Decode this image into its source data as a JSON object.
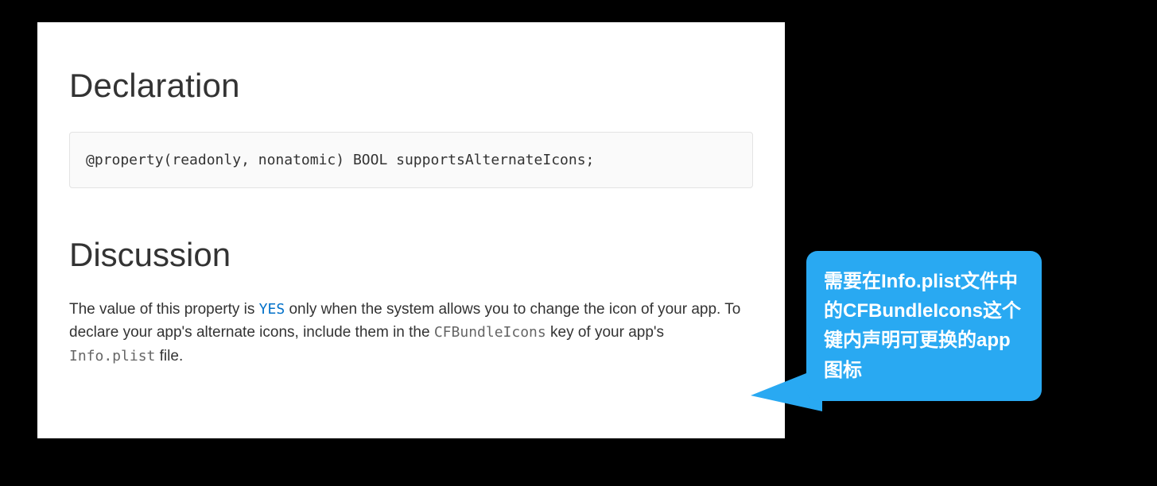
{
  "doc": {
    "declaration": {
      "heading": "Declaration",
      "code": "@property(readonly, nonatomic) BOOL supportsAlternateIcons;"
    },
    "discussion": {
      "heading": "Discussion",
      "pre": "The value of this property is ",
      "yes": "YES",
      "mid1": " only when the system allows you to change the icon of your app. To declare your app's alternate icons, include them in the ",
      "code1": "CFBundleIcons",
      "mid2": " key of your app's ",
      "code2": "Info.plist",
      "end": " file."
    }
  },
  "callout": {
    "text": "需要在Info.plist文件中的CFBundleIcons这个键内声明可更换的app图标"
  },
  "colors": {
    "callout_bg": "#29a9f2",
    "link_blue": "#0070c9"
  }
}
